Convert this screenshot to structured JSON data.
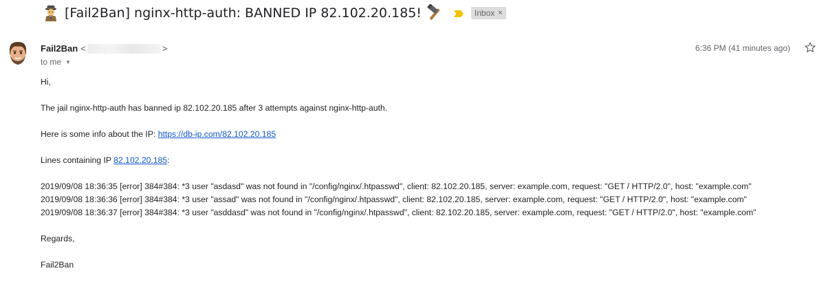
{
  "subject": {
    "text": "[Fail2Ban] nginx-http-auth: BANNED IP 82.102.20.185!",
    "label": "Inbox",
    "label_close": "×"
  },
  "message": {
    "sender_name": "Fail2Ban",
    "addr_open": "<",
    "addr_close": ">",
    "recipient": "to me",
    "time": "6:36 PM (41 minutes ago)"
  },
  "body": {
    "greeting": "Hi,",
    "line1": "The jail nginx-http-auth has banned ip 82.102.20.185 after 3 attempts against nginx-http-auth.",
    "info_prefix": "Here is some info about the IP: ",
    "info_link": "https://db-ip.com/82.102.20.185",
    "lines_prefix": "Lines containing IP ",
    "lines_link": "82.102.20.185",
    "lines_suffix": ":",
    "log_lines": [
      "2019/09/08 18:36:35 [error] 384#384: *3 user \"asdasd\" was not found in \"/config/nginx/.htpasswd\", client: 82.102.20.185, server: example.com, request: \"GET / HTTP/2.0\", host: \"example.com\"",
      "2019/09/08 18:36:36 [error] 384#384: *3 user \"assad\" was not found in \"/config/nginx/.htpasswd\", client: 82.102.20.185, server: example.com, request: \"GET / HTTP/2.0\", host: \"example.com\"",
      "2019/09/08 18:36:37 [error] 384#384: *3 user \"asddasd\" was not found in \"/config/nginx/.htpasswd\", client: 82.102.20.185, server: example.com, request: \"GET / HTTP/2.0\", host: \"example.com\""
    ],
    "regards": "Regards,",
    "signature": "Fail2Ban"
  },
  "colors": {
    "link": "#1155cc",
    "important_marker": "#f2c200",
    "label_chip_bg": "#dddddd"
  },
  "icons": {
    "subject_prefix": "detective-emoji-icon",
    "subject_suffix": "hammer-emoji-icon",
    "important": "important-marker-icon",
    "expand": "chevron-down-icon",
    "star": "star-outline-icon"
  }
}
